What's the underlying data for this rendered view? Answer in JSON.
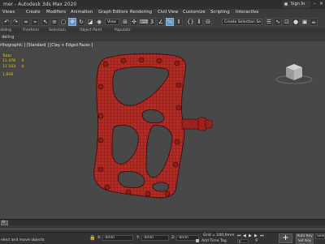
{
  "app": {
    "title": "mer - Autodesk 3ds Max 2020",
    "sign_in": "Sign In",
    "window_controls": [
      "minimize-icon",
      "maximize-icon",
      "close-icon"
    ]
  },
  "menu": {
    "items": [
      "Views",
      "Create",
      "Modifiers",
      "Animation",
      "Graph Editors",
      "Rendering",
      "Civil View",
      "Customize",
      "Scripting",
      "Interactive"
    ]
  },
  "toolbar": {
    "view_dropdown": "View",
    "selection_set": "Create Selection Se"
  },
  "ribbon": {
    "mode_label": "deling",
    "tabs": [
      "Freeform",
      "Selection",
      "Object Paint",
      "Populate"
    ]
  },
  "viewport": {
    "label": "rthographic ] [Standard ] [Clay + Edged Faces ]",
    "stats": {
      "header": "Total",
      "rows": [
        {
          "count": "11 478",
          "value": "0"
        },
        {
          "count": "11 503",
          "value": "0"
        }
      ],
      "fps": "1,848"
    },
    "viewcube_label": "",
    "model_color": "#b22a24",
    "background_color": "#474747"
  },
  "timeline": {
    "frame": "0"
  },
  "status": {
    "selection_text": "",
    "prompt": "elect and move objects",
    "x_label": "X:",
    "x_value": "-0mm",
    "y_label": "Y:",
    "y_value": "-0mm",
    "z_label": "Z:",
    "z_value": "-0mm",
    "grid": "Grid = 100,0mm",
    "add_time_tag": "Add Time Tag",
    "auto_key": "Auto Key",
    "set_key": "Set Key",
    "selected": "Selected",
    "frame_input": "0"
  }
}
